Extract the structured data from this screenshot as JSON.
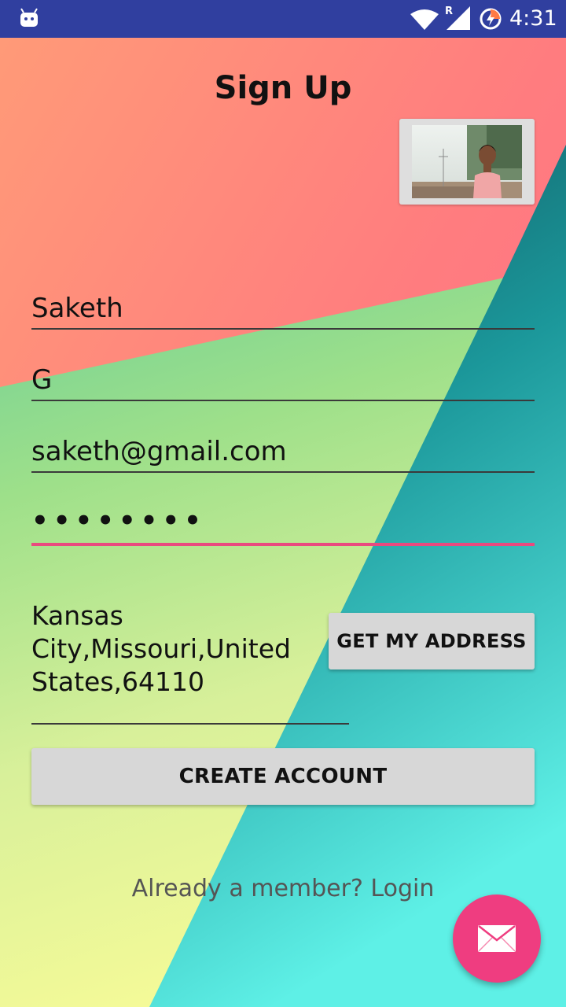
{
  "status_bar": {
    "time": "4:31",
    "roaming_indicator": "R",
    "icons": [
      "android-icon",
      "wifi-icon",
      "signal-icon",
      "battery-charging-icon"
    ],
    "background_color": "#303f9f"
  },
  "page": {
    "title": "Sign Up"
  },
  "profile_photo": {
    "icon": "profile-photo"
  },
  "form": {
    "first_name": {
      "value": "Saketh"
    },
    "last_name": {
      "value": "G"
    },
    "email": {
      "value": "saketh@gmail.com"
    },
    "password": {
      "value": "••••••••",
      "focused": true
    },
    "address": {
      "value": "Kansas City,Missouri,United States,64110",
      "button_label": "GET MY ADDRESS"
    },
    "create_button_label": "CREATE ACCOUNT",
    "login_link": "Already a member? Login"
  },
  "fab": {
    "icon": "mail-icon",
    "color": "#ef3d80"
  },
  "colors": {
    "accent": "#e94a7f",
    "button_background": "#d7d7d7"
  }
}
